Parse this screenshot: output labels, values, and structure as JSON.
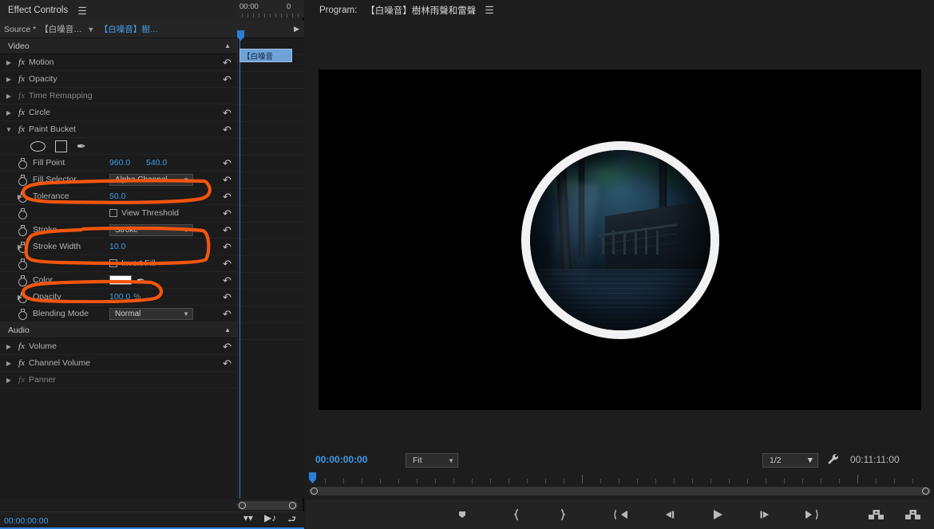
{
  "effect_controls": {
    "tab_label": "Effect Controls",
    "menu_icon": "hamburger-menu-icon",
    "source_label": "Source *",
    "source_clip_short": "【白噪音…",
    "sequence_clip": "【白噪音】樹…",
    "timeline_label_start": "00:00",
    "timeline_label_next": "0",
    "clip_bar_label": "【白噪音",
    "footer_timecode": "00:00:00:00",
    "groups": [
      {
        "name": "Video",
        "collapse_icon": "triangle-up-icon"
      },
      {
        "name": "Audio",
        "collapse_icon": "triangle-up-icon"
      }
    ],
    "video_effects": [
      {
        "label": "Motion",
        "disclosure": "collapsed",
        "fx": true,
        "dim": false,
        "reset": true
      },
      {
        "label": "Opacity",
        "disclosure": "collapsed",
        "fx": true,
        "dim": false,
        "reset": true
      },
      {
        "label": "Time Remapping",
        "disclosure": "collapsed",
        "fx": true,
        "dim": true,
        "reset": false
      },
      {
        "label": "Circle",
        "disclosure": "collapsed",
        "fx": true,
        "dim": false,
        "reset": true
      },
      {
        "label": "Paint Bucket",
        "disclosure": "expanded",
        "fx": true,
        "dim": false,
        "reset": true
      }
    ],
    "paint_bucket_tools": [
      "ellipse-tool-icon",
      "rectangle-tool-icon",
      "pen-tool-icon"
    ],
    "paint_bucket_params": [
      {
        "label": "Fill Point",
        "type": "point",
        "value_x": "960.0",
        "value_y": "540.0"
      },
      {
        "label": "Fill Selector",
        "type": "dropdown",
        "value": "Alpha Channel"
      },
      {
        "label": "Tolerance",
        "type": "number",
        "value": "50.0",
        "disclosure": "collapsed"
      },
      {
        "label": "View Threshold",
        "type": "checkbox",
        "checked": false
      },
      {
        "label": "Stroke",
        "type": "dropdown",
        "value": "Stroke"
      },
      {
        "label": "Stroke Width",
        "type": "number",
        "value": "10.0",
        "disclosure": "collapsed"
      },
      {
        "label": "Invert Fill",
        "type": "checkbox",
        "checked": false
      },
      {
        "label": "Color",
        "type": "color",
        "value": "#ffffff",
        "eyedropper": "eyedropper-icon"
      },
      {
        "label": "Opacity",
        "type": "number",
        "value": "100.0",
        "unit": "%",
        "disclosure": "collapsed"
      },
      {
        "label": "Blending Mode",
        "type": "dropdown",
        "value": "Normal"
      }
    ],
    "audio_effects": [
      {
        "label": "Volume",
        "disclosure": "collapsed",
        "fx": true,
        "dim": false,
        "reset": true
      },
      {
        "label": "Channel Volume",
        "disclosure": "collapsed",
        "fx": true,
        "dim": false,
        "reset": true
      },
      {
        "label": "Panner",
        "disclosure": "collapsed",
        "fx": true,
        "dim": true,
        "reset": false
      }
    ],
    "footer_icons": [
      "filter-icon",
      "audio-keyframe-icon",
      "export-frame-icon"
    ]
  },
  "program_monitor": {
    "tab_prefix": "Program:",
    "tab_title": "【白噪音】樹林雨聲和雷聲",
    "menu_icon": "hamburger-menu-icon",
    "playhead_timecode": "00:00:00:00",
    "zoom_level": "Fit",
    "playback_resolution": "1/2",
    "settings_icon": "wrench-icon",
    "duration_timecode": "00:11:11:00",
    "transport_buttons": [
      {
        "name": "add-marker-button",
        "icon": "marker-icon"
      },
      {
        "name": "mark-in-button",
        "icon": "mark-in-icon"
      },
      {
        "name": "mark-out-button",
        "icon": "mark-out-icon"
      },
      {
        "name": "go-to-in-button",
        "icon": "go-to-in-icon"
      },
      {
        "name": "step-back-button",
        "icon": "step-back-icon"
      },
      {
        "name": "play-stop-button",
        "icon": "play-icon"
      },
      {
        "name": "step-forward-button",
        "icon": "step-forward-icon"
      },
      {
        "name": "go-to-out-button",
        "icon": "go-to-out-icon"
      },
      {
        "name": "lift-button",
        "icon": "lift-icon"
      },
      {
        "name": "extract-button",
        "icon": "extract-icon"
      },
      {
        "name": "export-frame-button",
        "icon": "camera-icon"
      },
      {
        "name": "comparison-view-button",
        "icon": "comparison-view-icon"
      },
      {
        "name": "export-button",
        "icon": "export-icon"
      },
      {
        "name": "button-editor-button",
        "icon": "plus-icon"
      }
    ]
  },
  "annotations": {
    "color": "#f4550e",
    "shapes": [
      {
        "name": "fill-selector-highlight",
        "target": "Fill Selector"
      },
      {
        "name": "stroke-group-highlight",
        "target": "Stroke / Stroke Width"
      },
      {
        "name": "color-highlight",
        "target": "Color"
      }
    ]
  },
  "theme": {
    "panel_bg": "#1e1e1e",
    "list_bg": "#1b1b1b",
    "header_bg": "#232323",
    "accent_blue": "#3e9ae8",
    "annotation_orange": "#f4550e"
  }
}
